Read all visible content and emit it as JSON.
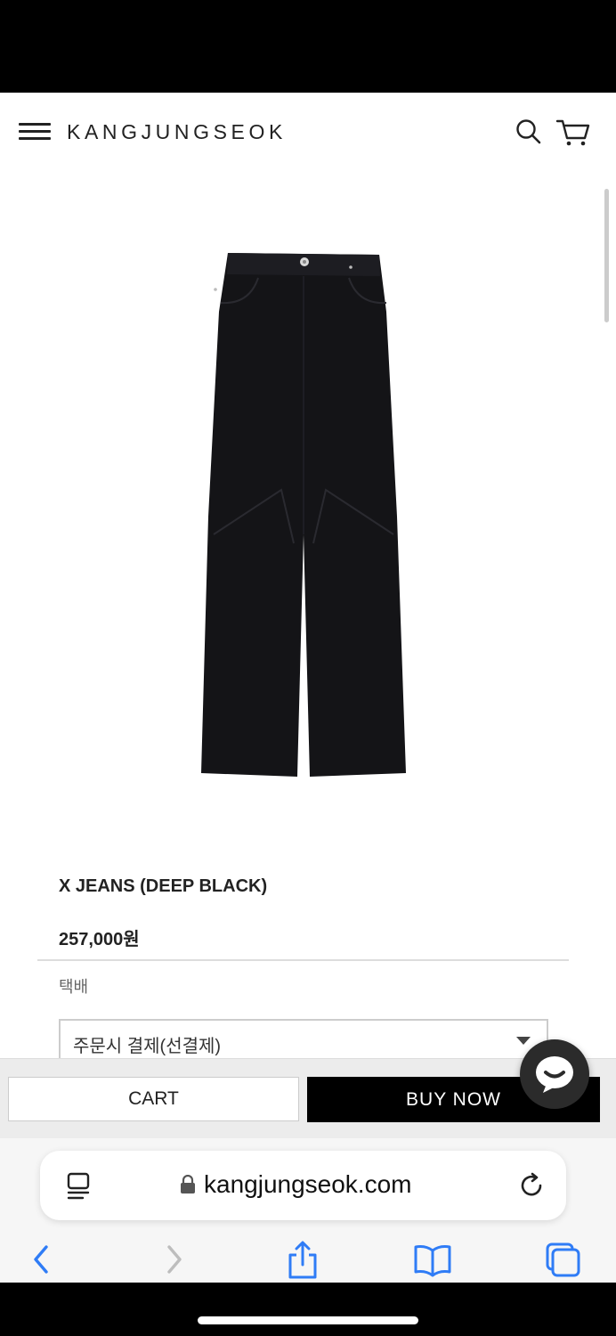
{
  "header": {
    "logo": "KANGJUNGSEOK"
  },
  "product": {
    "name": "X JEANS (DEEP BLACK)",
    "price": "257,000원",
    "shipping_label": "택배",
    "payment_select": {
      "value": "주문시 결제(선결제)"
    }
  },
  "actions": {
    "cart_label": "CART",
    "buy_label": "BUY NOW"
  },
  "browser": {
    "url": "kangjungseok.com"
  },
  "colors": {
    "primary": "#000000",
    "background": "#ffffff",
    "ios_accent": "#2f7cf6"
  },
  "icons": {
    "menu": "hamburger-icon",
    "search": "search-icon",
    "cart": "cart-icon",
    "chat": "chat-icon",
    "reader": "reader-icon",
    "lock": "lock-icon",
    "reload": "reload-icon",
    "back": "back-icon",
    "forward": "forward-icon",
    "share": "share-icon",
    "bookmarks": "bookmarks-icon",
    "tabs": "tabs-icon"
  }
}
